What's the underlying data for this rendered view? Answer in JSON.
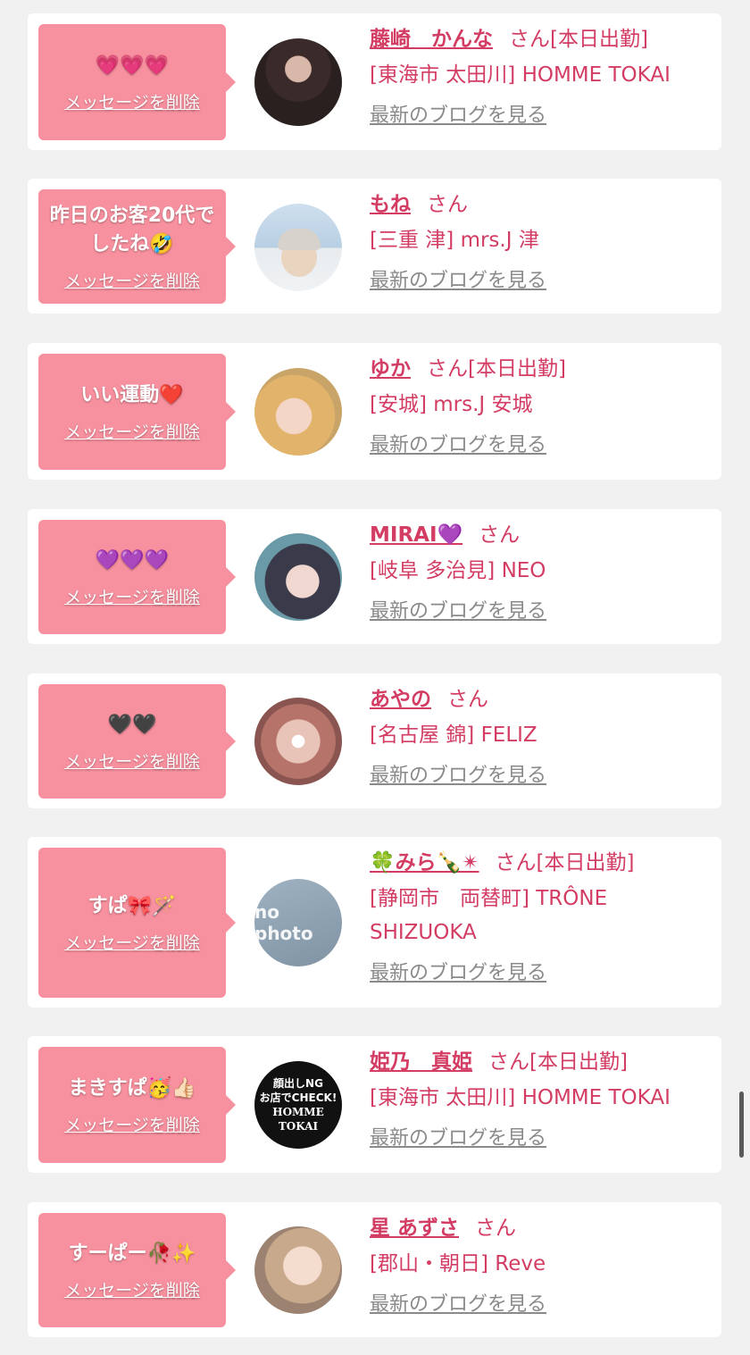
{
  "common": {
    "delete_label": "メッセージを削除",
    "san_label": "さん",
    "blog_label": "最新のブログを見る"
  },
  "cards": [
    {
      "message": "💗💗💗",
      "name": "藤崎　かんな",
      "status": "[本日出勤]",
      "shop": "[東海市 太田川] HOMME TOKAI"
    },
    {
      "message": "昨日のお客20代でしたね🤣",
      "name": "もね",
      "status": "",
      "shop": "[三重 津] mrs.J 津"
    },
    {
      "message": "いい運動❤️",
      "name": "ゆか",
      "status": "[本日出勤]",
      "shop": "[安城] mrs.J 安城"
    },
    {
      "message": "💜💜💜",
      "name": "MIRAI💜",
      "status": "",
      "shop": "[岐阜 多治見] NEO"
    },
    {
      "message": "🖤🖤",
      "name": "あやの",
      "status": "",
      "shop": "[名古屋 錦] FELIZ"
    },
    {
      "message": "すぱ🎀🪄",
      "name": "🍀みら🍾✴︎",
      "status": "[本日出勤]",
      "shop": "[静岡市　両替町] TRÔNE SHIZUOKA",
      "avatar_text": "no photo"
    },
    {
      "message": "まきすぱ🥳👍🏻",
      "name": "姫乃　真姫",
      "status": "[本日出勤]",
      "shop": "[東海市 太田川] HOMME TOKAI",
      "avatar_text_1": "顔出しNG",
      "avatar_text_2": "お店でCHECK!",
      "avatar_text_3": "HOMME TOKAI"
    },
    {
      "message": "すーぱー🥀✨",
      "name": "星 あずさ",
      "status": "",
      "shop": "[郡山・朝日] Reve"
    }
  ],
  "colors": {
    "accent": "#d33c63",
    "bubble": "#f8919f",
    "background": "#f1f1f1"
  }
}
